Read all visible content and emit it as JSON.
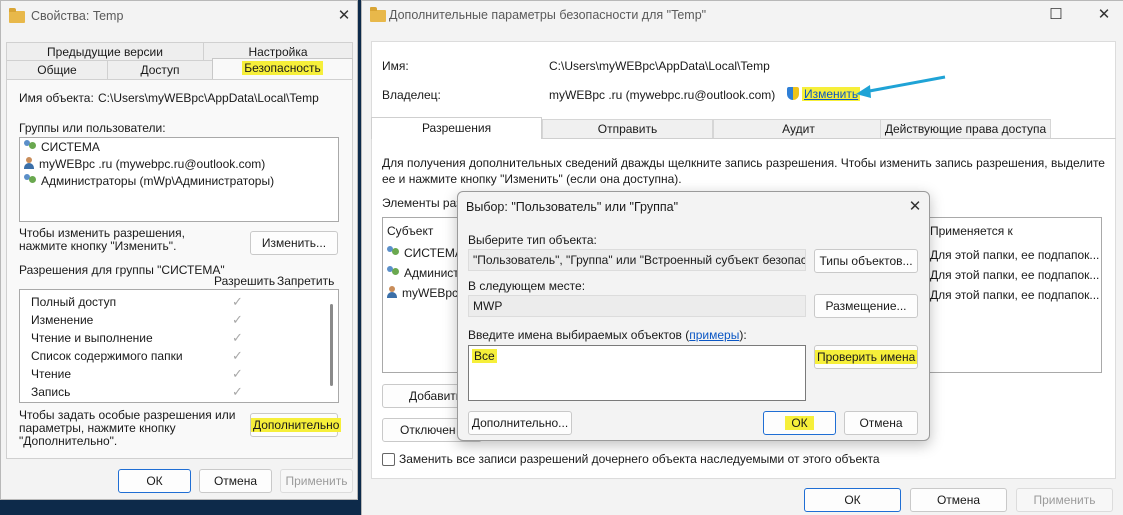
{
  "left": {
    "title": "Свойства: Temp",
    "tabs_row1": [
      "Предыдущие версии",
      "Настройка"
    ],
    "tabs_row2": [
      "Общие",
      "Доступ",
      "Безопасность"
    ],
    "object_label": "Имя объекта:",
    "object_value": "C:\\Users\\myWEBpc\\AppData\\Local\\Temp",
    "groups_label": "Группы или пользователи:",
    "groups": [
      "СИСТЕМА",
      "myWEBpc .ru (mywebpc.ru@outlook.com)",
      "Администраторы (mWp\\Администраторы)"
    ],
    "change_hint": "Чтобы изменить разрешения,\nнажмите кнопку \"Изменить\".",
    "change_button": "Изменить...",
    "perm_for_label": "Разрешения для группы \"СИСТЕМА\"",
    "col_allow": "Разрешить",
    "col_deny": "Запретить",
    "permissions": [
      "Полный доступ",
      "Изменение",
      "Чтение и выполнение",
      "Список содержимого папки",
      "Чтение",
      "Запись"
    ],
    "advanced_hint": "Чтобы задать особые разрешения или\nпараметры, нажмите кнопку\n\"Дополнительно\".",
    "advanced_button": "Дополнительно",
    "ok": "ОК",
    "cancel": "Отмена",
    "apply": "Применить"
  },
  "right": {
    "title": "Дополнительные параметры безопасности  для \"Temp\"",
    "name_label": "Имя:",
    "name_value": "C:\\Users\\myWEBpc\\AppData\\Local\\Temp",
    "owner_label": "Владелец:",
    "owner_value": "myWEBpc .ru (mywebpc.ru@outlook.com)",
    "change_link": "Изменить",
    "tabs": [
      "Разрешения",
      "Отправить",
      "Аудит",
      "Действующие права доступа"
    ],
    "info": "Для получения дополнительных сведений дважды щелкните запись разрешения. Чтобы изменить запись разрешения, выделите\nее и нажмите кнопку \"Изменить\" (если она доступна).",
    "elements_label": "Элементы раз",
    "col_subject": "Субъект",
    "col_applies": "Применяется к",
    "rows": [
      {
        "subject": "СИСТЕМА",
        "applies": "Для этой папки, ее подпапок..."
      },
      {
        "subject": "Админист",
        "applies": "Для этой папки, ее подпапок..."
      },
      {
        "subject": "myWEBpc",
        "applies": "Для этой папки, ее подпапок..."
      }
    ],
    "add_button": "Добавить",
    "disable_button": "Отключен",
    "replace_checkbox": "Заменить все записи разрешений дочернего объекта наследуемыми от этого объекта",
    "ok": "ОК",
    "cancel": "Отмена",
    "apply": "Применить"
  },
  "dialog": {
    "title": "Выбор: \"Пользователь\" или \"Группа\"",
    "type_label": "Выберите тип объекта:",
    "type_value": "\"Пользователь\", \"Группа\" или \"Встроенный субъект безопасност",
    "types_button": "Типы объектов...",
    "location_label": "В следующем месте:",
    "location_value": "MWP",
    "location_button": "Размещение...",
    "names_label_prefix": "Введите имена выбираемых объектов (",
    "names_link": "примеры",
    "names_label_suffix": "):",
    "names_value": "Все",
    "check_button": "Проверить имена",
    "advanced_button": "Дополнительно...",
    "ok": "ОК",
    "cancel": "Отмена"
  },
  "colors": {
    "highlight": "#f6ef3a",
    "accent": "#1f6ed4",
    "arrow": "#1fa3d6",
    "link": "#0b57c4"
  }
}
